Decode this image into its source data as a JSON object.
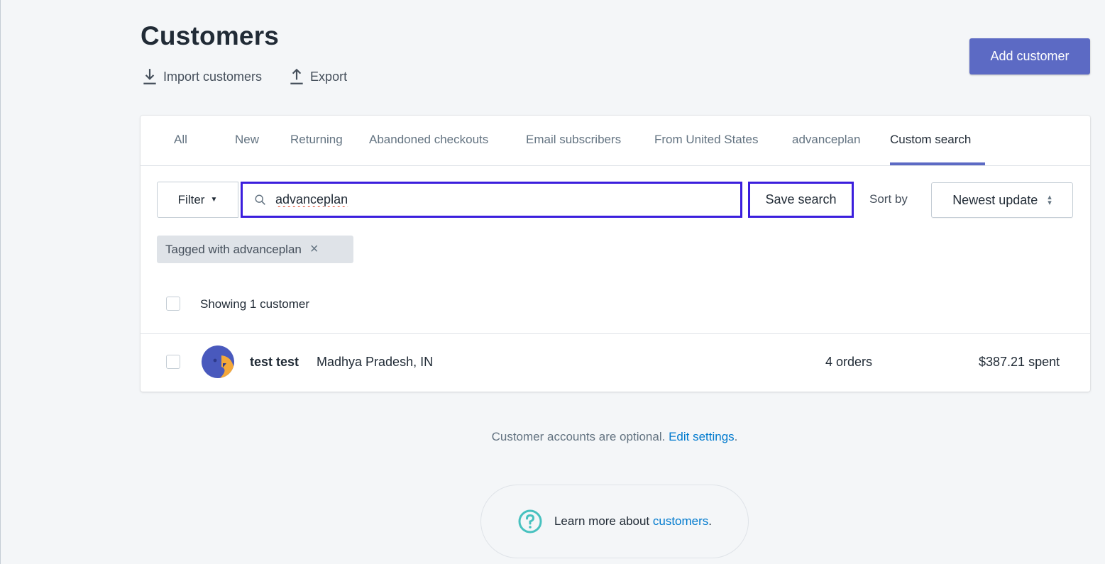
{
  "header": {
    "title": "Customers",
    "import_label": "Import customers",
    "export_label": "Export",
    "add_button_label": "Add customer"
  },
  "tabs": [
    {
      "label": "All"
    },
    {
      "label": "New"
    },
    {
      "label": "Returning"
    },
    {
      "label": "Abandoned checkouts"
    },
    {
      "label": "Email subscribers"
    },
    {
      "label": "From United States"
    },
    {
      "label": "advanceplan"
    },
    {
      "label": "Custom search",
      "active": true
    }
  ],
  "search": {
    "filter_label": "Filter",
    "value": "advanceplan",
    "save_label": "Save search",
    "sort_label": "Sort by",
    "sort_value": "Newest update"
  },
  "tag_chip": {
    "label": "Tagged with advanceplan"
  },
  "list": {
    "showing_label": "Showing 1 customer",
    "customers": [
      {
        "name": "test test",
        "location": "Madhya Pradesh, IN",
        "orders": "4 orders",
        "spent": "$387.21 spent"
      }
    ]
  },
  "footer": {
    "accounts_text": "Customer accounts are optional. ",
    "edit_settings_link": "Edit settings",
    "period": ".",
    "learn_text": "Learn more about ",
    "customers_link": "customers",
    "learn_period": "."
  },
  "colors": {
    "accent": "#5c6ac4",
    "highlight_border": "#3b1edd",
    "link": "#007ace",
    "help_teal": "#47c1bf"
  }
}
